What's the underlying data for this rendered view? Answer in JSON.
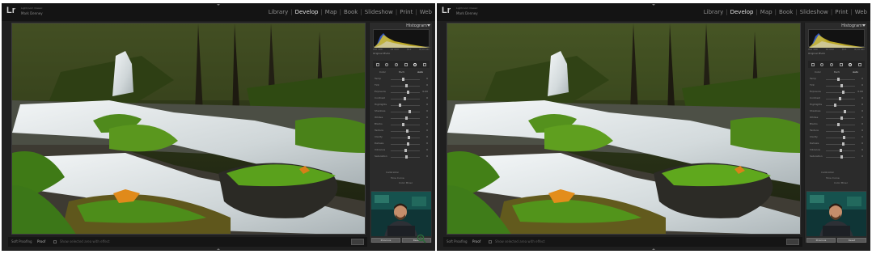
{
  "app": {
    "logo": "Lr",
    "identity_line1": "Lightroom Classic",
    "identity_line2": "Mark Denney",
    "modules": [
      {
        "label": "Library",
        "active": false
      },
      {
        "label": "Develop",
        "active": true
      },
      {
        "label": "Map",
        "active": false
      },
      {
        "label": "Book",
        "active": false
      },
      {
        "label": "Slideshow",
        "active": false
      },
      {
        "label": "Print",
        "active": false
      },
      {
        "label": "Web",
        "active": false
      }
    ]
  },
  "left": {
    "panel": {
      "title": "Histogram",
      "hist": [
        "ISO 100",
        "14 mm",
        "f/11",
        "6/10 sec"
      ],
      "orig": "Original Photo",
      "pills": [
        "Color",
        "B&W",
        "Auto"
      ],
      "slider_labels": [
        "Temp",
        "Tint",
        "Exposure",
        "Contrast",
        "Highlights",
        "Shadows",
        "Whites",
        "Blacks",
        "Texture",
        "Clarity",
        "Dehaze",
        "Vibrance",
        "Saturation"
      ],
      "slider_values": [
        "0",
        "0",
        "0.00",
        "0",
        "0",
        "0",
        "0",
        "0",
        "0",
        "0",
        "0",
        "0",
        "0"
      ],
      "extra": [
        "Calibration",
        "Tone Curve",
        "Color Mixer"
      ],
      "buttons": {
        "previous": "Previous",
        "reset": "Reset"
      }
    },
    "toolbar": {
      "label": "Soft Proofing",
      "toggle": "Proof",
      "note": "Show selected area with effect"
    }
  },
  "right": {
    "panel": {
      "title": "Histogram",
      "hist": [
        "ISO 100",
        "14 mm",
        "f/11",
        "6/10 sec"
      ],
      "orig": "Original Photo",
      "pills": [
        "Color",
        "B&W",
        "Auto"
      ],
      "slider_labels": [
        "Temp",
        "Tint",
        "Exposure",
        "Contrast",
        "Highlights",
        "Shadows",
        "Whites",
        "Blacks",
        "Texture",
        "Clarity",
        "Dehaze",
        "Vibrance",
        "Saturation"
      ],
      "slider_values": [
        "0",
        "0",
        "0.00",
        "0",
        "0",
        "0",
        "0",
        "0",
        "0",
        "0",
        "0",
        "0",
        "0"
      ],
      "extra": [
        "Calibration",
        "Tone Curve",
        "Color Mixer"
      ],
      "buttons": {
        "previous": "Previous",
        "reset": "Reset"
      }
    },
    "toolbar": {
      "label": "Soft Proofing",
      "toggle": "Proof",
      "note": "Show selected area with effect"
    }
  },
  "colors": {
    "chrome": "#1f1f1f",
    "panel": "#2b2b2b",
    "moss": "#4f8a1c",
    "water": "#e6eef0",
    "leaf": "#e08a1a"
  },
  "icons": [
    "zoom-icon"
  ]
}
